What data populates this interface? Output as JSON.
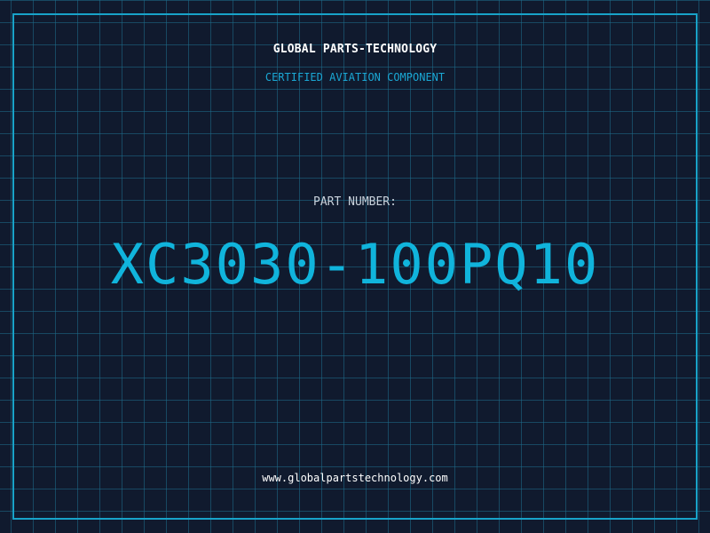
{
  "header": {
    "title": "GLOBAL PARTS-TECHNOLOGY",
    "subtitle": "CERTIFIED AVIATION COMPONENT"
  },
  "main": {
    "part_label": "PART NUMBER:",
    "part_number": "XC3030-100PQ10"
  },
  "footer": {
    "website": "www.globalpartstechnology.com"
  },
  "colors": {
    "background": "#101a2e",
    "grid": "#1e6e8c",
    "accent": "#10b4dc",
    "frame": "#18a3c9",
    "text": "#ffffff"
  }
}
